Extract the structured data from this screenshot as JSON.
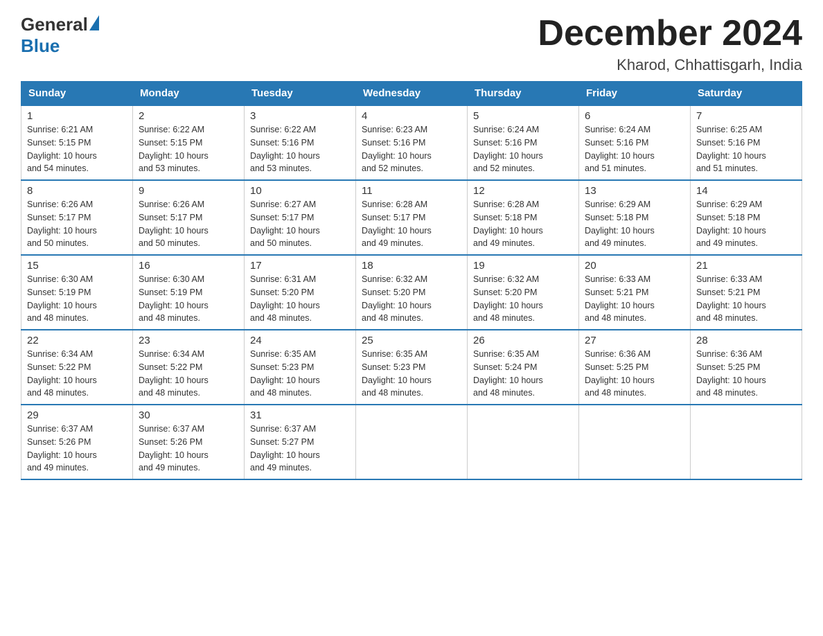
{
  "logo": {
    "general": "General",
    "blue": "Blue"
  },
  "title": "December 2024",
  "location": "Kharod, Chhattisgarh, India",
  "days_of_week": [
    "Sunday",
    "Monday",
    "Tuesday",
    "Wednesday",
    "Thursday",
    "Friday",
    "Saturday"
  ],
  "weeks": [
    [
      {
        "day": "1",
        "sunrise": "6:21 AM",
        "sunset": "5:15 PM",
        "daylight": "10 hours and 54 minutes."
      },
      {
        "day": "2",
        "sunrise": "6:22 AM",
        "sunset": "5:15 PM",
        "daylight": "10 hours and 53 minutes."
      },
      {
        "day": "3",
        "sunrise": "6:22 AM",
        "sunset": "5:16 PM",
        "daylight": "10 hours and 53 minutes."
      },
      {
        "day": "4",
        "sunrise": "6:23 AM",
        "sunset": "5:16 PM",
        "daylight": "10 hours and 52 minutes."
      },
      {
        "day": "5",
        "sunrise": "6:24 AM",
        "sunset": "5:16 PM",
        "daylight": "10 hours and 52 minutes."
      },
      {
        "day": "6",
        "sunrise": "6:24 AM",
        "sunset": "5:16 PM",
        "daylight": "10 hours and 51 minutes."
      },
      {
        "day": "7",
        "sunrise": "6:25 AM",
        "sunset": "5:16 PM",
        "daylight": "10 hours and 51 minutes."
      }
    ],
    [
      {
        "day": "8",
        "sunrise": "6:26 AM",
        "sunset": "5:17 PM",
        "daylight": "10 hours and 50 minutes."
      },
      {
        "day": "9",
        "sunrise": "6:26 AM",
        "sunset": "5:17 PM",
        "daylight": "10 hours and 50 minutes."
      },
      {
        "day": "10",
        "sunrise": "6:27 AM",
        "sunset": "5:17 PM",
        "daylight": "10 hours and 50 minutes."
      },
      {
        "day": "11",
        "sunrise": "6:28 AM",
        "sunset": "5:17 PM",
        "daylight": "10 hours and 49 minutes."
      },
      {
        "day": "12",
        "sunrise": "6:28 AM",
        "sunset": "5:18 PM",
        "daylight": "10 hours and 49 minutes."
      },
      {
        "day": "13",
        "sunrise": "6:29 AM",
        "sunset": "5:18 PM",
        "daylight": "10 hours and 49 minutes."
      },
      {
        "day": "14",
        "sunrise": "6:29 AM",
        "sunset": "5:18 PM",
        "daylight": "10 hours and 49 minutes."
      }
    ],
    [
      {
        "day": "15",
        "sunrise": "6:30 AM",
        "sunset": "5:19 PM",
        "daylight": "10 hours and 48 minutes."
      },
      {
        "day": "16",
        "sunrise": "6:30 AM",
        "sunset": "5:19 PM",
        "daylight": "10 hours and 48 minutes."
      },
      {
        "day": "17",
        "sunrise": "6:31 AM",
        "sunset": "5:20 PM",
        "daylight": "10 hours and 48 minutes."
      },
      {
        "day": "18",
        "sunrise": "6:32 AM",
        "sunset": "5:20 PM",
        "daylight": "10 hours and 48 minutes."
      },
      {
        "day": "19",
        "sunrise": "6:32 AM",
        "sunset": "5:20 PM",
        "daylight": "10 hours and 48 minutes."
      },
      {
        "day": "20",
        "sunrise": "6:33 AM",
        "sunset": "5:21 PM",
        "daylight": "10 hours and 48 minutes."
      },
      {
        "day": "21",
        "sunrise": "6:33 AM",
        "sunset": "5:21 PM",
        "daylight": "10 hours and 48 minutes."
      }
    ],
    [
      {
        "day": "22",
        "sunrise": "6:34 AM",
        "sunset": "5:22 PM",
        "daylight": "10 hours and 48 minutes."
      },
      {
        "day": "23",
        "sunrise": "6:34 AM",
        "sunset": "5:22 PM",
        "daylight": "10 hours and 48 minutes."
      },
      {
        "day": "24",
        "sunrise": "6:35 AM",
        "sunset": "5:23 PM",
        "daylight": "10 hours and 48 minutes."
      },
      {
        "day": "25",
        "sunrise": "6:35 AM",
        "sunset": "5:23 PM",
        "daylight": "10 hours and 48 minutes."
      },
      {
        "day": "26",
        "sunrise": "6:35 AM",
        "sunset": "5:24 PM",
        "daylight": "10 hours and 48 minutes."
      },
      {
        "day": "27",
        "sunrise": "6:36 AM",
        "sunset": "5:25 PM",
        "daylight": "10 hours and 48 minutes."
      },
      {
        "day": "28",
        "sunrise": "6:36 AM",
        "sunset": "5:25 PM",
        "daylight": "10 hours and 48 minutes."
      }
    ],
    [
      {
        "day": "29",
        "sunrise": "6:37 AM",
        "sunset": "5:26 PM",
        "daylight": "10 hours and 49 minutes."
      },
      {
        "day": "30",
        "sunrise": "6:37 AM",
        "sunset": "5:26 PM",
        "daylight": "10 hours and 49 minutes."
      },
      {
        "day": "31",
        "sunrise": "6:37 AM",
        "sunset": "5:27 PM",
        "daylight": "10 hours and 49 minutes."
      },
      null,
      null,
      null,
      null
    ]
  ],
  "labels": {
    "sunrise": "Sunrise:",
    "sunset": "Sunset:",
    "daylight": "Daylight:"
  }
}
